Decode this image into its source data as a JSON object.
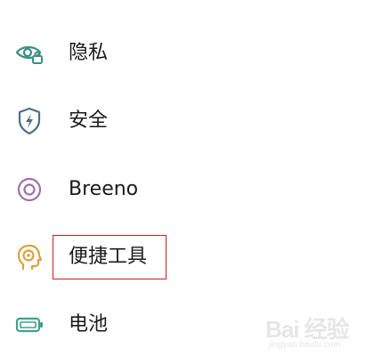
{
  "settings": {
    "items": [
      {
        "label": "隐私",
        "icon": "eye-lock-icon",
        "color": "#3d8f86"
      },
      {
        "label": "安全",
        "icon": "shield-bolt-icon",
        "color": "#4d6f88"
      },
      {
        "label": "Breeno",
        "icon": "breeno-ring-icon",
        "color": "#a06fa8"
      },
      {
        "label": "便捷工具",
        "icon": "head-target-icon",
        "color": "#d9a23e"
      },
      {
        "label": "电池",
        "icon": "battery-icon",
        "color": "#3fa38c"
      }
    ]
  },
  "highlight": {
    "target": "便捷工具",
    "color": "#c81d25"
  },
  "watermark": {
    "text": "Bai 经验",
    "url": "jingyan.baidu.com"
  }
}
